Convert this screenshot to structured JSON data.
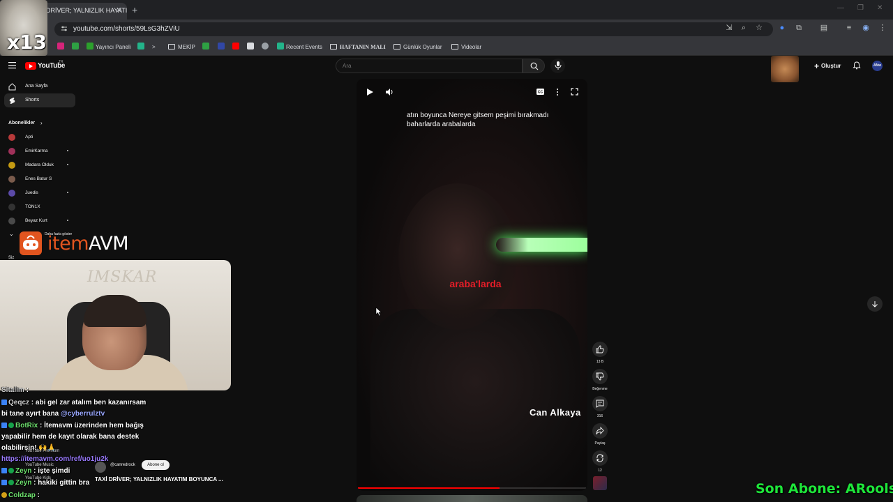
{
  "browser": {
    "tab_title": "DRİVER; YALNIZLIK HAYATIM",
    "url": "youtube.com/shorts/59LsG3hZViU",
    "bookmarks": [
      {
        "label": "Yayıncı Paneli",
        "color": "#2ca02c"
      },
      {
        "label": "MEKİP",
        "type": "folder"
      },
      {
        "label": "Recent Events",
        "color": "#23b48a"
      },
      {
        "label": "HAFTANIN MALI",
        "type": "folder"
      },
      {
        "label": "Günlük Oyunlar",
        "type": "folder"
      },
      {
        "label": "Videolar",
        "type": "folder"
      }
    ]
  },
  "overlay": {
    "cat_label": "x13",
    "brand_prefix": "item",
    "brand_suffix": "AVM",
    "webcam_watermark": "IMSKAR",
    "last_subscriber": "Son Abone: ARoolse"
  },
  "youtube": {
    "logo_text": "YouTube",
    "logo_region": "TR",
    "search_placeholder": "Ara",
    "create_label": "Oluştur",
    "avatar_text": "ANw",
    "sidebar": {
      "home": "Ana Sayfa",
      "shorts": "Shorts",
      "subscriptions_header": "Abonelikler",
      "subscriptions": [
        {
          "name": "Apti",
          "color": "#b83a3a",
          "dot": false
        },
        {
          "name": "EmirKarma",
          "color": "#a0315a",
          "dot": true
        },
        {
          "name": "Madara Olduk",
          "color": "#c49a12",
          "dot": true
        },
        {
          "name": "Enes Batur S",
          "color": "#7a5b4c",
          "dot": false
        },
        {
          "name": "Juedis",
          "color": "#5b4aa8",
          "dot": true
        },
        {
          "name": "TON1X",
          "color": "#333333",
          "dot": false
        },
        {
          "name": "Beyaz Kurt",
          "color": "#4a4a4a",
          "dot": true
        }
      ],
      "show_more": "Daha fazla göster",
      "you_header": "Siz"
    },
    "short": {
      "overlay_text": "atın boyunca Nereye gitsem peşimi bırakmadı baharlarda arabalarda",
      "lyric": "araba'larda",
      "artist": "Can  Alkaya",
      "progress": 0.62,
      "channel": "@canredrock",
      "subscribe_label": "Abone ol",
      "title": "TAXİ DRİVER; YALNIZLIK HAYATIM BOYUNCA ...",
      "likes": "13 B",
      "dislike_label": "Beğenme",
      "comments": "316",
      "share_label": "Paylaş",
      "remix_count": "12"
    }
  },
  "chat": {
    "l1_name": "Sitalim",
    "l1_text": " : ",
    "l2_name": "Qeqcz",
    "l2_text": " : abi gel zar atalım ben kazanırsam",
    "l3_text": "bi tane ayırt bana ",
    "l3_mention": "@cyberrulztv",
    "l4_name": "BotRix",
    "l4_text": " : İtemavm üzerinden hem bağış",
    "l5_text": "yapabilir hem de kayıt olarak bana destek",
    "l6_text": "olabilirsin! 🙌🙏",
    "l7_link": "https://itemavm.com/ref/uo1ju2k",
    "l8_name": "Zeyn",
    "l8_text": " : işte şimdi",
    "l9_name": "Zeyn",
    "l9_text": " : hakiki gittin bra",
    "l10_name": "Coldzap",
    "l10_text": " : ",
    "ghost_music": "YouTube Music",
    "ghost_kids": "YouTube Kids",
    "ghost_premium": "YouTube Premium"
  }
}
